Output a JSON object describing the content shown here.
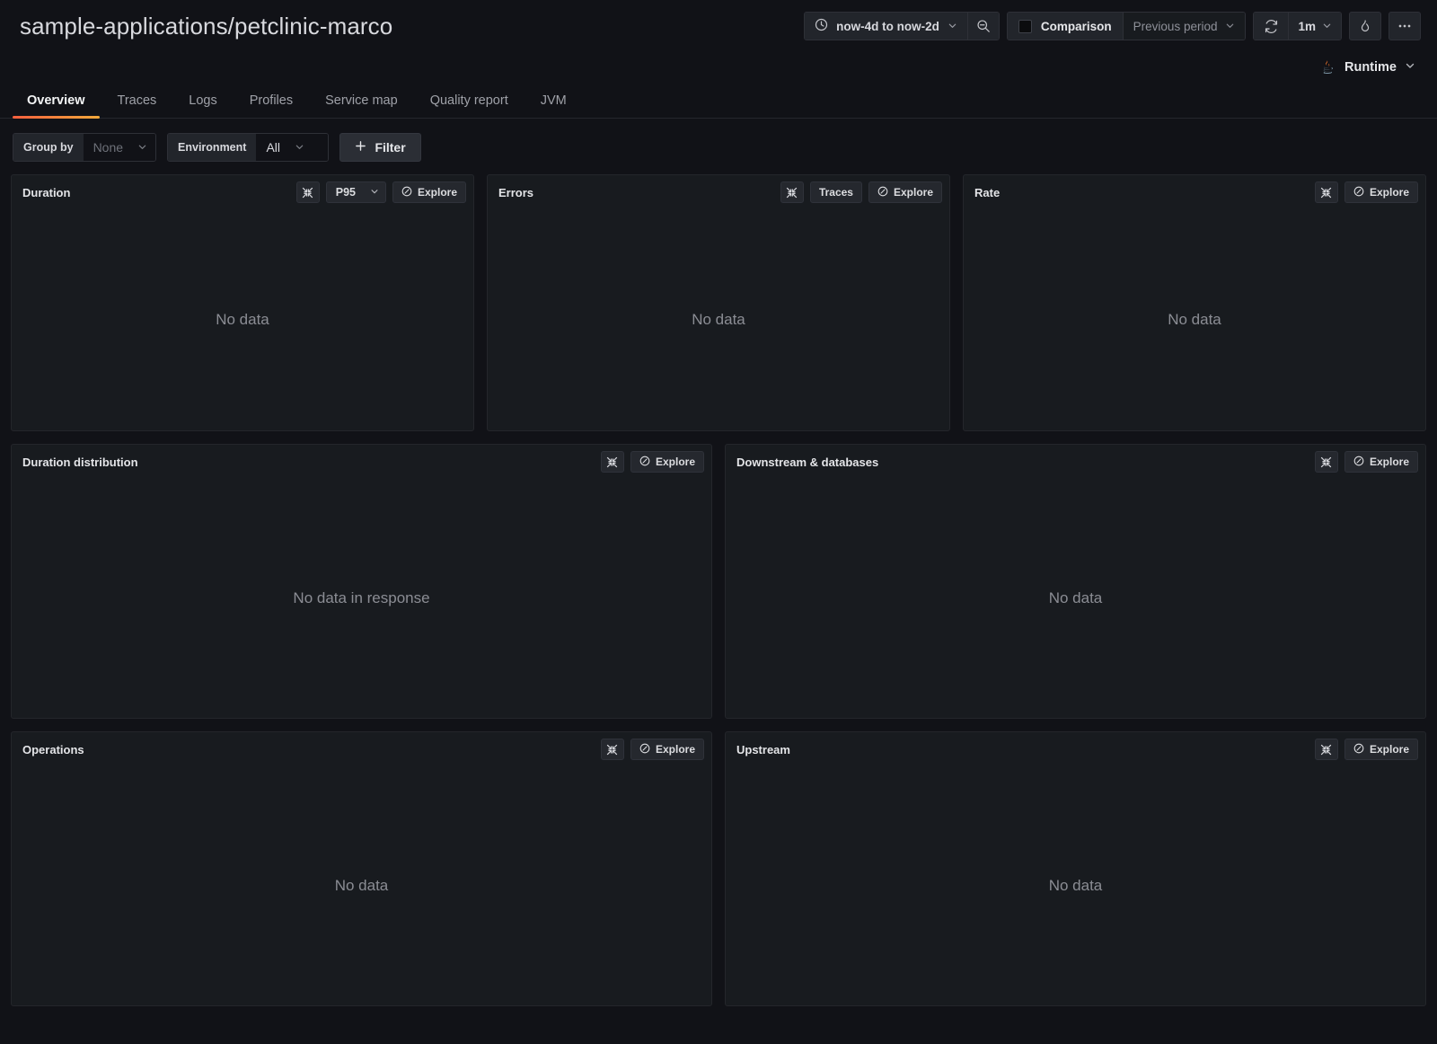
{
  "header": {
    "title": "sample-applications/petclinic-marco",
    "time_range": "now-4d to now-2d",
    "zoom_out_icon": "zoom-out-icon",
    "clock_icon": "clock-icon",
    "comparison_label": "Comparison",
    "comparison_period": "Previous period",
    "refresh_icon": "refresh-icon",
    "refresh_interval": "1m",
    "solo_icon": "flame-icon",
    "more_icon": "ellipsis-icon",
    "runtime_label": "Runtime",
    "runtime_icon": "java-icon"
  },
  "tabs": [
    {
      "label": "Overview",
      "active": true
    },
    {
      "label": "Traces",
      "active": false
    },
    {
      "label": "Logs",
      "active": false
    },
    {
      "label": "Profiles",
      "active": false
    },
    {
      "label": "Service map",
      "active": false
    },
    {
      "label": "Quality report",
      "active": false
    },
    {
      "label": "JVM",
      "active": false
    }
  ],
  "filters": {
    "group_by_label": "Group by",
    "group_by_value": "None",
    "environment_label": "Environment",
    "environment_value": "All",
    "filter_button": "Filter",
    "plus_icon": "plus-icon"
  },
  "common": {
    "explore_label": "Explore",
    "explore_icon": "compass-icon",
    "collapse_icon": "compress-arrows-icon",
    "no_data": "No data",
    "no_data_in_response": "No data in response"
  },
  "panels": {
    "duration": {
      "title": "Duration",
      "percentile": "P95",
      "body_text": "No data"
    },
    "errors": {
      "title": "Errors",
      "traces_label": "Traces",
      "body_text": "No data"
    },
    "rate": {
      "title": "Rate",
      "body_text": "No data"
    },
    "duration_distribution": {
      "title": "Duration distribution",
      "body_text": "No data in response"
    },
    "downstream": {
      "title": "Downstream & databases",
      "body_text": "No data"
    },
    "operations": {
      "title": "Operations",
      "body_text": "No data"
    },
    "upstream": {
      "title": "Upstream",
      "body_text": "No data"
    }
  },
  "colors": {
    "page_bg": "#111217",
    "panel_bg": "#181b1f",
    "accent_start": "#f55f3e",
    "accent_end": "#f2a93b",
    "text_primary": "#d8d9de",
    "text_muted": "#8b8d94"
  }
}
